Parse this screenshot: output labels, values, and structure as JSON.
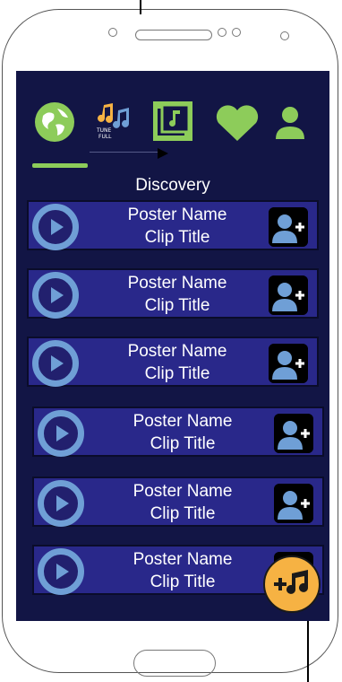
{
  "nav": {
    "tabs": [
      {
        "name": "discovery",
        "icon": "globe-icon"
      },
      {
        "name": "tunefull",
        "icon": "music-notes-logo-icon",
        "logo_text": "TUNE FULL"
      },
      {
        "name": "library",
        "icon": "music-library-icon"
      },
      {
        "name": "favorites",
        "icon": "heart-icon"
      },
      {
        "name": "profile",
        "icon": "user-icon"
      }
    ]
  },
  "main": {
    "title": "Discovery",
    "rows": [
      {
        "poster": "Poster Name",
        "clip": "Clip Title"
      },
      {
        "poster": "Poster Name",
        "clip": "Clip Title"
      },
      {
        "poster": "Poster Name",
        "clip": "Clip Title"
      },
      {
        "poster": "Poster Name",
        "clip": "Clip Title"
      },
      {
        "poster": "Poster Name",
        "clip": "Clip Title"
      },
      {
        "poster": "Poster Name",
        "clip": "Clip Title"
      }
    ]
  },
  "fab": {
    "icon": "add-music-icon",
    "color": "#f6b243"
  },
  "colors": {
    "screen_bg": "#121545",
    "row_bg": "#29288a",
    "accent_green": "#8dcc5a",
    "play_blue": "#6f9fd6"
  }
}
